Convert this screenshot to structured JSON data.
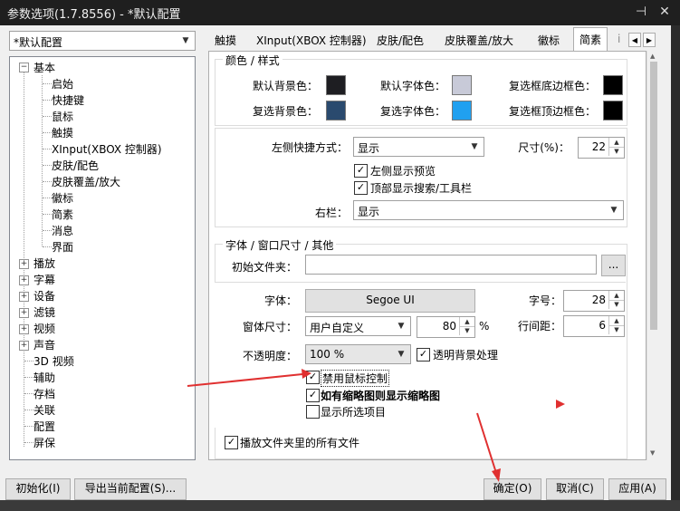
{
  "window": {
    "title": "参数选项(1.7.8556) - *默认配置",
    "pin_icon": "pin-icon",
    "close_icon": "close-icon"
  },
  "profile_select": {
    "value": "*默认配置"
  },
  "tabs": [
    {
      "label": "触摸"
    },
    {
      "label": "XInput(XBOX 控制器)"
    },
    {
      "label": "皮肤/配色"
    },
    {
      "label": "皮肤覆盖/放大"
    },
    {
      "label": "徽标"
    },
    {
      "label": "简素",
      "active": true
    },
    {
      "label": "i"
    }
  ],
  "tree": {
    "root": "基本",
    "basic_children": [
      "启始",
      "快捷键",
      "鼠标",
      "触摸",
      "XInput(XBOX 控制器)",
      "皮肤/配色",
      "皮肤覆盖/放大",
      "徽标",
      "简素",
      "消息",
      "界面"
    ],
    "expandable": [
      "播放",
      "字幕",
      "设备",
      "滤镜",
      "视频",
      "声音"
    ],
    "plain": [
      "3D 视频",
      "辅助",
      "存档",
      "关联",
      "配置",
      "屏保"
    ]
  },
  "colors_group": {
    "title": "颜色 / 样式",
    "items": [
      {
        "label": "默认背景色：",
        "color": "#1e1e22"
      },
      {
        "label": "默认字体色：",
        "color": "#c8cad8"
      },
      {
        "label": "复选框底边框色：",
        "color": "#000000"
      },
      {
        "label": "复选背景色：",
        "color": "#2a4a6e"
      },
      {
        "label": "复选字体色：",
        "color": "#20a0f0"
      },
      {
        "label": "复选框顶边框色：",
        "color": "#000000"
      }
    ]
  },
  "layout_group": {
    "left_shortcut_label": "左侧快捷方式：",
    "left_shortcut_value": "显示",
    "size_label": "尺寸(%)：",
    "size_value": "22",
    "left_preview": "左侧显示预览",
    "top_search": "顶部显示搜索/工具栏",
    "right_bar_label": "右栏：",
    "right_bar_value": "显示"
  },
  "font_group": {
    "title": "字体 / 窗口尺寸 / 其他",
    "init_folder_label": "初始文件夹：",
    "init_folder_value": "",
    "browse_label": "...",
    "font_label": "字体：",
    "font_value": "Segoe UI",
    "font_size_label": "字号：",
    "font_size_value": "28",
    "window_size_label": "窗体尺寸：",
    "window_size_mode": "用户自定义",
    "window_size_value": "80",
    "percent": "%",
    "line_spacing_label": "行间距：",
    "line_spacing_value": "6",
    "opacity_label": "不透明度：",
    "opacity_value": "100 %",
    "transparent_bg": "透明背景处理",
    "disable_mouse": "禁用鼠标控制",
    "show_thumbnail": "如有缩略图则显示缩略图",
    "show_selected": "显示所选项目",
    "play_all_files": "播放文件夹里的所有文件"
  },
  "footer": {
    "init": "初始化(I)",
    "export": "导出当前配置(S)...",
    "ok": "确定(O)",
    "cancel": "取消(C)",
    "apply": "应用(A)"
  },
  "annotation_color": "#e03030"
}
